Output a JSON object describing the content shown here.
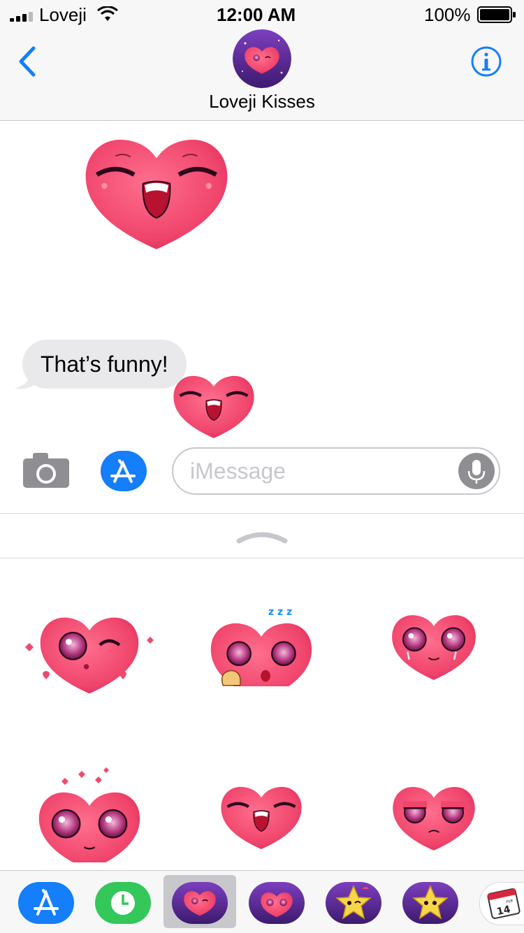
{
  "status_bar": {
    "carrier": "Loveji",
    "time": "12:00 AM",
    "battery": "100%"
  },
  "header": {
    "title": "Loveji Kisses"
  },
  "messages": {
    "bubble_text": "That’s funny!"
  },
  "composer": {
    "placeholder": "iMessage"
  },
  "sticker_grid": {
    "rows": 2,
    "columns": 3,
    "items": [
      "wink-hearts",
      "sleepy-yawn",
      "happy-tears",
      "love-hearts",
      "laughing",
      "sad"
    ]
  },
  "app_tray": {
    "items": [
      "app-store-icon",
      "recents-icon",
      "loveji-kisses-app",
      "loveji-crying-app",
      "star-wink-app",
      "star-app",
      "calendar-feb-14-app"
    ],
    "selected_index": 2,
    "calendar_day": "14",
    "calendar_month": "FEB"
  },
  "colors": {
    "ios_blue": "#147efb",
    "heart_pink": "#f0456c",
    "app_purple": "#5b2d8e",
    "green": "#34c759"
  }
}
